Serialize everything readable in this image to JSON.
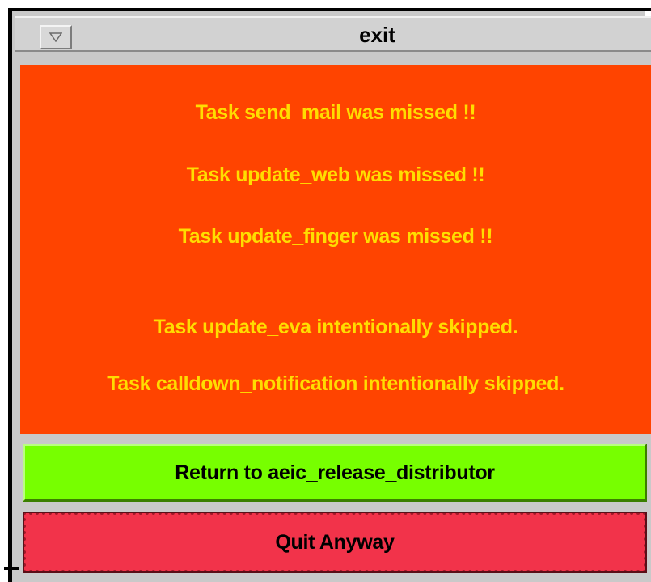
{
  "window": {
    "title": "exit",
    "menu_icon": "window-menu-triangle-icon"
  },
  "messages": [
    "Task send_mail was missed !!",
    "Task update_web was missed !!",
    "Task update_finger was missed !!",
    "Task update_eva intentionally skipped.",
    "Task calldown_notification intentionally skipped."
  ],
  "buttons": {
    "return_label": "Return to aeic_release_distributor",
    "quit_label": "Quit Anyway"
  },
  "colors": {
    "message_background": "#ff4400",
    "message_text": "#ffdd00",
    "return_button": "#77ff00",
    "quit_button": "#f2334a"
  }
}
